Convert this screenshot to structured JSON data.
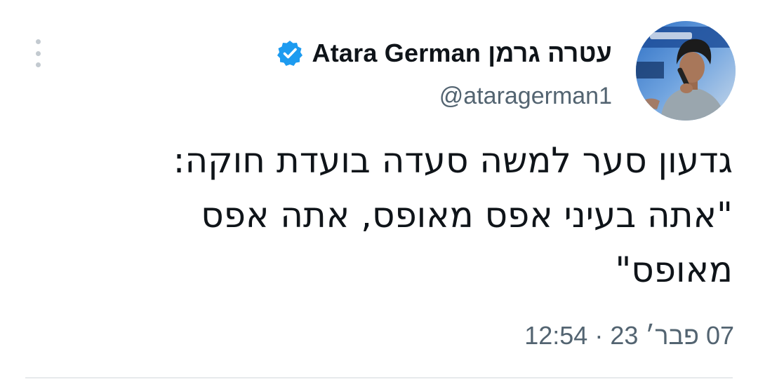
{
  "author": {
    "display_name": "עטרה גרמן Atara German",
    "handle": "@ataragerman1",
    "verified": true,
    "verified_color": "#1d9bf0",
    "avatar_icon": "user-avatar-photo"
  },
  "tweet": {
    "text_lines": [
      "גדעון סער למשה סעדה בועדת חוקה:",
      "\"אתה בעיני אפס מאופס, אתה אפס",
      "מאופס\""
    ],
    "time": "12:54",
    "separator": "·",
    "date": "07 פבר׳ 23"
  },
  "menu": {
    "icon": "more-vertical-icon"
  }
}
